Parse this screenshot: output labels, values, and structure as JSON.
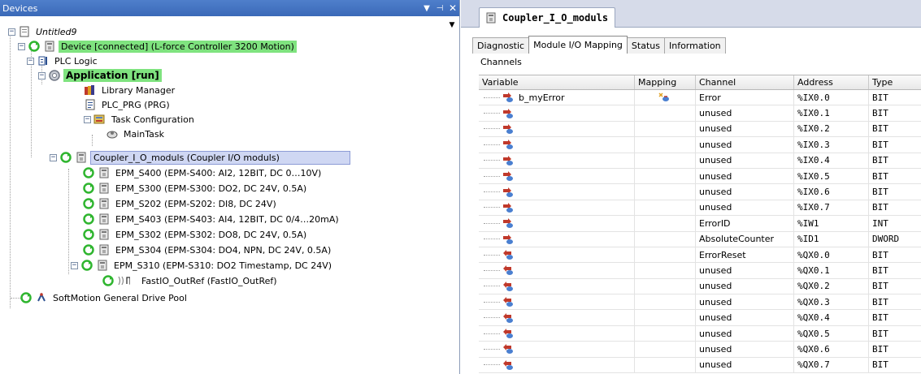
{
  "devices_pane": {
    "title": "Devices",
    "pin_icon": "pin-icon",
    "dropdown_icon": "dropdown-arrow-icon",
    "close_icon": "close-icon"
  },
  "tree": {
    "root": "Untitled9",
    "device": "Device [connected] (L-force Controller 3200 Motion)",
    "plc_logic": "PLC Logic",
    "application": "Application [run]",
    "library_manager": "Library Manager",
    "plc_prg": "PLC_PRG (PRG)",
    "task_configuration": "Task Configuration",
    "main_task": "MainTask",
    "coupler": "Coupler_I_O_moduls (Coupler I/O moduls)",
    "modules": [
      "EPM_S400 (EPM-S400: AI2, 12BIT, DC 0…10V)",
      "EPM_S300 (EPM-S300: DO2, DC 24V, 0.5A)",
      "EPM_S202 (EPM-S202: DI8, DC 24V)",
      "EPM_S403 (EPM-S403: AI4, 12BIT, DC 0/4…20mA)",
      "EPM_S302 (EPM-S302: DO8, DC 24V, 0.5A)",
      "EPM_S304 (EPM-S304: DO4, NPN, DC 24V, 0.5A)",
      "EPM_S310 (EPM-S310: DO2 Timestamp, DC 24V)"
    ],
    "fastio": "FastIO_OutRef (FastIO_OutRef)",
    "softmotion": "SoftMotion General Drive Pool"
  },
  "editor": {
    "doc_tab": "Coupler_I_O_moduls",
    "tabs": [
      "Diagnostic",
      "Module I/O Mapping",
      "Status",
      "Information"
    ],
    "active_tab": "Module I/O Mapping",
    "channels_label": "Channels",
    "columns": [
      "Variable",
      "Mapping",
      "Channel",
      "Address",
      "Type"
    ],
    "rows": [
      {
        "variable": "b_myError",
        "mapped": true,
        "channel": "Error",
        "address": "%IX0.0",
        "type": "BIT",
        "dir": "in"
      },
      {
        "variable": "",
        "mapped": false,
        "channel": "unused",
        "address": "%IX0.1",
        "type": "BIT",
        "dir": "in"
      },
      {
        "variable": "",
        "mapped": false,
        "channel": "unused",
        "address": "%IX0.2",
        "type": "BIT",
        "dir": "in"
      },
      {
        "variable": "",
        "mapped": false,
        "channel": "unused",
        "address": "%IX0.3",
        "type": "BIT",
        "dir": "in"
      },
      {
        "variable": "",
        "mapped": false,
        "channel": "unused",
        "address": "%IX0.4",
        "type": "BIT",
        "dir": "in"
      },
      {
        "variable": "",
        "mapped": false,
        "channel": "unused",
        "address": "%IX0.5",
        "type": "BIT",
        "dir": "in"
      },
      {
        "variable": "",
        "mapped": false,
        "channel": "unused",
        "address": "%IX0.6",
        "type": "BIT",
        "dir": "in"
      },
      {
        "variable": "",
        "mapped": false,
        "channel": "unused",
        "address": "%IX0.7",
        "type": "BIT",
        "dir": "in"
      },
      {
        "variable": "",
        "mapped": false,
        "channel": "ErrorID",
        "address": "%IW1",
        "type": "INT",
        "dir": "in"
      },
      {
        "variable": "",
        "mapped": false,
        "channel": "AbsoluteCounter",
        "address": "%ID1",
        "type": "DWORD",
        "dir": "in"
      },
      {
        "variable": "",
        "mapped": false,
        "channel": "ErrorReset",
        "address": "%QX0.0",
        "type": "BIT",
        "dir": "out"
      },
      {
        "variable": "",
        "mapped": false,
        "channel": "unused",
        "address": "%QX0.1",
        "type": "BIT",
        "dir": "out"
      },
      {
        "variable": "",
        "mapped": false,
        "channel": "unused",
        "address": "%QX0.2",
        "type": "BIT",
        "dir": "out"
      },
      {
        "variable": "",
        "mapped": false,
        "channel": "unused",
        "address": "%QX0.3",
        "type": "BIT",
        "dir": "out"
      },
      {
        "variable": "",
        "mapped": false,
        "channel": "unused",
        "address": "%QX0.4",
        "type": "BIT",
        "dir": "out"
      },
      {
        "variable": "",
        "mapped": false,
        "channel": "unused",
        "address": "%QX0.5",
        "type": "BIT",
        "dir": "out"
      },
      {
        "variable": "",
        "mapped": false,
        "channel": "unused",
        "address": "%QX0.6",
        "type": "BIT",
        "dir": "out"
      },
      {
        "variable": "",
        "mapped": false,
        "channel": "unused",
        "address": "%QX0.7",
        "type": "BIT",
        "dir": "out"
      }
    ]
  },
  "colors": {
    "titlebar": "#3f6fbf",
    "running_highlight": "#7fe37f",
    "selection": "#cfd7f3"
  }
}
